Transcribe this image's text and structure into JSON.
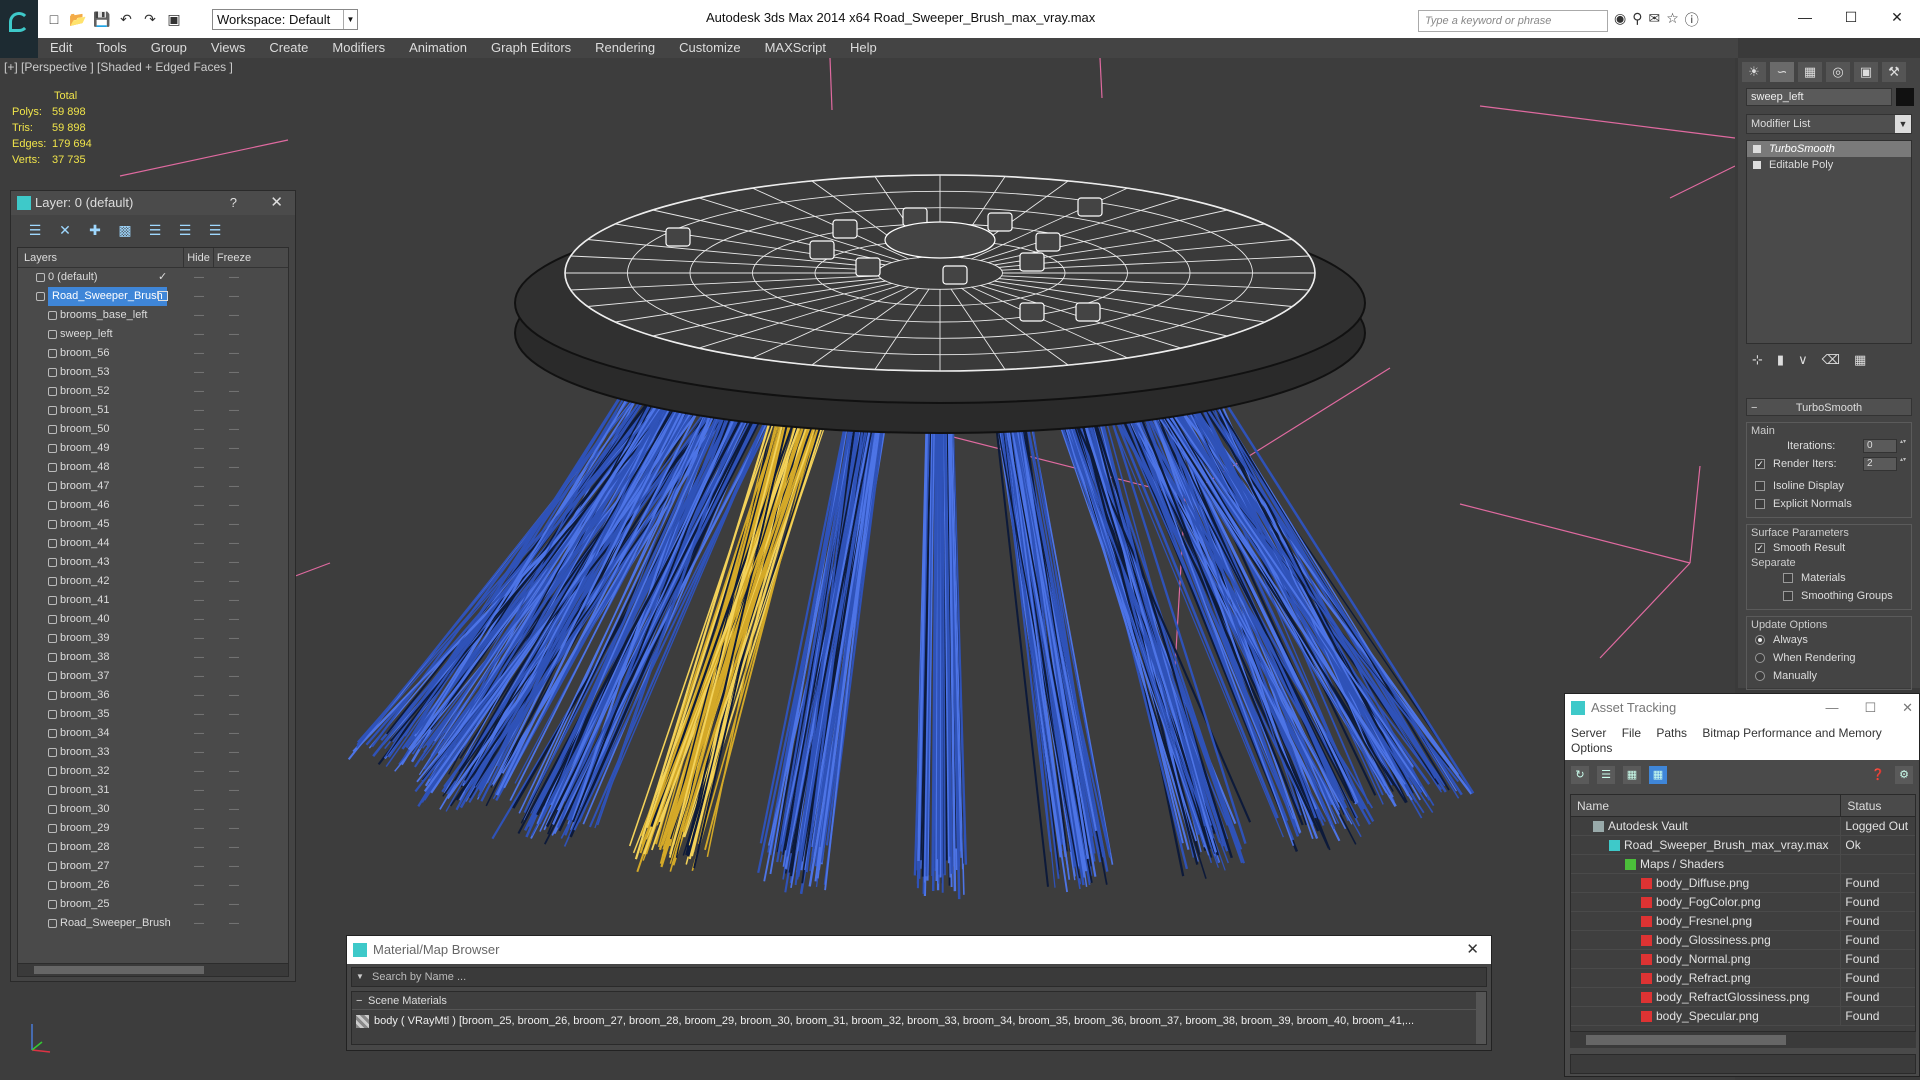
{
  "titlebar": {
    "workspace": "Workspace: Default",
    "app_title": "Autodesk 3ds Max  2014 x64     Road_Sweeper_Brush_max_vray.max",
    "search_placeholder": "Type a keyword or phrase"
  },
  "menu": [
    "Edit",
    "Tools",
    "Group",
    "Views",
    "Create",
    "Modifiers",
    "Animation",
    "Graph Editors",
    "Rendering",
    "Customize",
    "MAXScript",
    "Help"
  ],
  "viewport": {
    "label": "[+] [Perspective ] [Shaded + Edged Faces ]",
    "stats_header": "Total",
    "stats": [
      {
        "label": "Polys:",
        "value": "59 898"
      },
      {
        "label": "Tris:",
        "value": "59 898"
      },
      {
        "label": "Edges:",
        "value": "179 694"
      },
      {
        "label": "Verts:",
        "value": "37 735"
      }
    ]
  },
  "layers": {
    "title": "Layer: 0 (default)",
    "help": "?",
    "col_layers": "Layers",
    "col_hide": "Hide",
    "col_freeze": "Freeze",
    "rows": [
      {
        "name": "0 (default)",
        "level": 1,
        "check": true
      },
      {
        "name": "Road_Sweeper_Brush",
        "level": 1,
        "selected": true
      },
      {
        "name": "brooms_base_left",
        "level": 2
      },
      {
        "name": "sweep_left",
        "level": 2
      },
      {
        "name": "broom_56",
        "level": 2
      },
      {
        "name": "broom_53",
        "level": 2
      },
      {
        "name": "broom_52",
        "level": 2
      },
      {
        "name": "broom_51",
        "level": 2
      },
      {
        "name": "broom_50",
        "level": 2
      },
      {
        "name": "broom_49",
        "level": 2
      },
      {
        "name": "broom_48",
        "level": 2
      },
      {
        "name": "broom_47",
        "level": 2
      },
      {
        "name": "broom_46",
        "level": 2
      },
      {
        "name": "broom_45",
        "level": 2
      },
      {
        "name": "broom_44",
        "level": 2
      },
      {
        "name": "broom_43",
        "level": 2
      },
      {
        "name": "broom_42",
        "level": 2
      },
      {
        "name": "broom_41",
        "level": 2
      },
      {
        "name": "broom_40",
        "level": 2
      },
      {
        "name": "broom_39",
        "level": 2
      },
      {
        "name": "broom_38",
        "level": 2
      },
      {
        "name": "broom_37",
        "level": 2
      },
      {
        "name": "broom_36",
        "level": 2
      },
      {
        "name": "broom_35",
        "level": 2
      },
      {
        "name": "broom_34",
        "level": 2
      },
      {
        "name": "broom_33",
        "level": 2
      },
      {
        "name": "broom_32",
        "level": 2
      },
      {
        "name": "broom_31",
        "level": 2
      },
      {
        "name": "broom_30",
        "level": 2
      },
      {
        "name": "broom_29",
        "level": 2
      },
      {
        "name": "broom_28",
        "level": 2
      },
      {
        "name": "broom_27",
        "level": 2
      },
      {
        "name": "broom_26",
        "level": 2
      },
      {
        "name": "broom_25",
        "level": 2
      },
      {
        "name": "Road_Sweeper_Brush",
        "level": 2
      }
    ]
  },
  "command_panel": {
    "object_name": "sweep_left",
    "modifier_list": "Modifier List",
    "stack": [
      {
        "name": "TurboSmooth",
        "active": true
      },
      {
        "name": "Editable Poly",
        "active": false
      }
    ],
    "rollout_title": "TurboSmooth",
    "main_label": "Main",
    "iterations_label": "Iterations:",
    "iterations_value": "0",
    "render_iters_label": "Render Iters:",
    "render_iters_value": "2",
    "isoline_label": "Isoline Display",
    "explicit_normals_label": "Explicit Normals",
    "surface_label": "Surface Parameters",
    "smooth_result_label": "Smooth Result",
    "separate_label": "Separate",
    "materials_label": "Materials",
    "smoothing_groups_label": "Smoothing Groups",
    "update_label": "Update Options",
    "always_label": "Always",
    "when_rendering_label": "When Rendering",
    "manually_label": "Manually"
  },
  "material_browser": {
    "title": "Material/Map Browser",
    "search_placeholder": "Search by Name ...",
    "category": "Scene Materials",
    "item": "body  ( VRayMtl ) [broom_25, broom_26, broom_27, broom_28, broom_29, broom_30, broom_31, broom_32, broom_33, broom_34, broom_35, broom_36, broom_37, broom_38, broom_39, broom_40, broom_41,..."
  },
  "asset_tracking": {
    "title": "Asset Tracking",
    "menu": [
      "Server",
      "File",
      "Paths",
      "Bitmap Performance and Memory",
      "Options"
    ],
    "col_name": "Name",
    "col_status": "Status",
    "rows": [
      {
        "name": "Autodesk Vault",
        "status": "Logged Out",
        "level": 1,
        "icon": "vault"
      },
      {
        "name": "Road_Sweeper_Brush_max_vray.max",
        "status": "Ok",
        "level": 2,
        "icon": "max"
      },
      {
        "name": "Maps / Shaders",
        "status": "",
        "level": 3,
        "icon": "folder"
      },
      {
        "name": "body_Diffuse.png",
        "status": "Found",
        "level": 4,
        "icon": "png"
      },
      {
        "name": "body_FogColor.png",
        "status": "Found",
        "level": 4,
        "icon": "png"
      },
      {
        "name": "body_Fresnel.png",
        "status": "Found",
        "level": 4,
        "icon": "png"
      },
      {
        "name": "body_Glossiness.png",
        "status": "Found",
        "level": 4,
        "icon": "png"
      },
      {
        "name": "body_Normal.png",
        "status": "Found",
        "level": 4,
        "icon": "png"
      },
      {
        "name": "body_Refract.png",
        "status": "Found",
        "level": 4,
        "icon": "png"
      },
      {
        "name": "body_RefractGlossiness.png",
        "status": "Found",
        "level": 4,
        "icon": "png"
      },
      {
        "name": "body_Specular.png",
        "status": "Found",
        "level": 4,
        "icon": "png"
      }
    ]
  },
  "colors": {
    "bristle_blue": "#2f52b8",
    "bristle_yellow": "#d4a928",
    "selection": "#3f86d8",
    "stats_text": "#f0e44a"
  }
}
